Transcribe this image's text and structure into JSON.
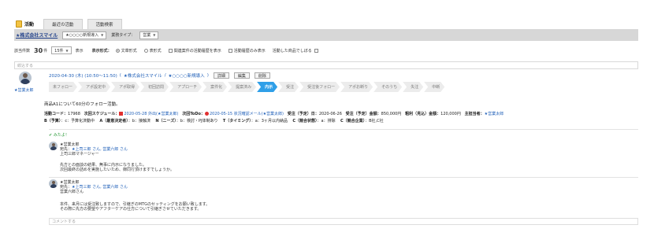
{
  "tabs": {
    "main": "活動",
    "recent": "最近の活動",
    "search": "活動検索"
  },
  "company": {
    "name": "★株式会社スマイル",
    "project_select": "★○○○○新規導入",
    "type_label": "業務タイプ：",
    "type_select": "営業"
  },
  "toolbar": {
    "count_label": "該当件数",
    "count_value": "30",
    "count_unit": "件",
    "per_page": "15件",
    "show_label": "表示",
    "format_label": "表示形式：",
    "format_text": "文章形式",
    "format_table": "表形式",
    "opt_related": "関連案件の活動履歴を表示",
    "opt_only": "活動履歴のみ表示",
    "opt_product": "活動した商品でしぼる"
  },
  "search": {
    "placeholder": "絞込する"
  },
  "activity": {
    "user": "★営業太郎",
    "datetime": "2020-04-30 (木) (10:50〜11:50)",
    "company_link": "★株式会社スマイル",
    "project_link": "★○○○○新規導入",
    "btn_detail": "詳細",
    "btn_edit": "編集",
    "btn_delete": "削除",
    "pipeline": [
      "未フォロー",
      "アポ設定中",
      "アポ取得",
      "初回訪問",
      "アプローチ",
      "案件化",
      "提案済み",
      "内示",
      "受注",
      "受注後フォロー",
      "アポお断り",
      "そのうち",
      "失注",
      "中断"
    ],
    "pipeline_active": 7,
    "summary": "商品A1について60分のフォロー活動。",
    "line1": {
      "code_label": "活動コード：",
      "code": "17968",
      "next_label": "次回スケジュール：",
      "next_link": "2020-05-28 外出(★営業太郎)",
      "todo_label": "次回ToDo：",
      "todo_link": "2020-05-15 状況確認メール(★営業太郎)",
      "order_date_label": "受注（予定）日：",
      "order_date": "2020-06-26",
      "amount_label": "受注（予定）金額：",
      "amount": "850,000円",
      "profit_label": "粗利（見込）金額：",
      "profit": "120,000円",
      "owner_label": "主担当者：",
      "owner": "★営業太郎"
    },
    "line2": {
      "b_label": "B（予算）",
      "b_value": "：c：予算化済動中",
      "a_label": "A（最意決定者）",
      "a_value": "：b：接触済",
      "n_label": "N（ニーズ）",
      "n_value": "：b：検討・PJ体制あり",
      "t_label": "T（タイミング）",
      "t_value": "：a：3ヶ月以内納品",
      "c1_label": "C（競合状態）",
      "c1_value": "：a：排除",
      "c2_label": "C（競合企業）",
      "c2_value": "：B社,C社"
    }
  },
  "comments": {
    "likes": "✔ みたよ！",
    "items": [
      {
        "author": "★営業太郎",
        "to_label": "宛先：",
        "to": "★上司三郎 さん, 営業六郎 さん",
        "to_plain": "上司三郎マネージャー",
        "body1": "先方との面談の結果、無事に内示になりました。",
        "body2": "次回最終の詰めを実施したいため、御同行頂けますでしょうか。"
      },
      {
        "author": "★営業太郎",
        "to_label": "宛先：",
        "to": "★上司三郎 さん, 営業六郎 さん",
        "to_plain": "営業六郎さん",
        "body1": "本件、来月には受注致しますので、引継ぎのMTGのセッティングをお願い致します。",
        "body2": "その際に先方の要望やアフターケアの仕方について引継ぎさせていただきます。"
      }
    ],
    "input_placeholder": "コメントする"
  }
}
